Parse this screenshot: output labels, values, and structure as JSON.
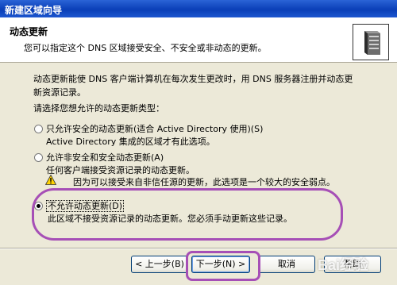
{
  "window": {
    "title": "新建区域向导"
  },
  "header": {
    "title": "动态更新",
    "subtitle": "您可以指定这个 DNS 区域接受安全、不安全或非动态的更新。",
    "icon": "server-icon"
  },
  "content": {
    "intro_line1": "动态更新能使 DNS 客户端计算机在每次发生更改时，用 DNS 服务器注册并动态更",
    "intro_line2": "新资源记录。",
    "prompt": "请选择您想允许的动态更新类型：",
    "options": [
      {
        "label": "只允许安全的动态更新(适合 Active Directory 使用)(S)",
        "desc": "Active Directory 集成的区域才有此选项。",
        "checked": false
      },
      {
        "label": "允许非安全和安全动态更新(A)",
        "desc": "任何客户端接受资源记录的动态更新。",
        "warning": "因为可以接受来自非信任源的更新，此选项是一个较大的安全弱点。",
        "warning_icon": "warning-icon",
        "checked": false
      },
      {
        "label": "不允许动态更新(D)",
        "desc": "此区域不接受资源记录的动态更新。您必须手动更新这些记录。",
        "checked": true
      }
    ]
  },
  "buttons": {
    "back": "< 上一步(B)",
    "next": "下一步(N) >",
    "cancel": "取消",
    "help": "帮助"
  },
  "watermark": "Bai经验",
  "colors": {
    "titlebar": "#0a3fb7",
    "dialog_bg": "#ece9d8",
    "highlight": "#a64fb6"
  }
}
